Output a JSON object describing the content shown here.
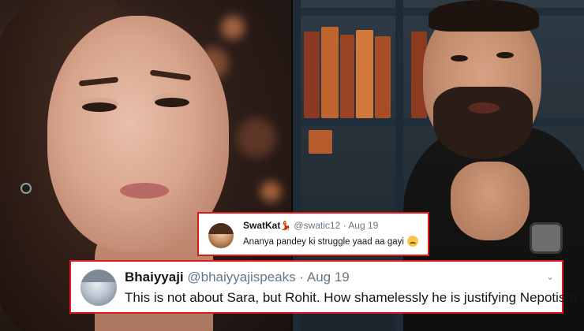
{
  "tweets": [
    {
      "name": "SwatKat",
      "name_emoji": "💃",
      "handle": "@swatic12",
      "separator": "·",
      "date": "Aug 19",
      "text": "Ananya pandey ki struggle yaad aa gayi",
      "text_emoji": "crying-face"
    },
    {
      "name": "Bhaiyyaji",
      "handle": "@bhaiyyajispeaks",
      "separator": "·",
      "date": "Aug 19",
      "text": "This is not about Sara, but Rohit. How shamelessly he is justifying Nepotism.",
      "caret": "⌄"
    }
  ],
  "colors": {
    "highlight_border": "#e0181b",
    "name_text": "#14171a",
    "meta_text": "#657786"
  }
}
